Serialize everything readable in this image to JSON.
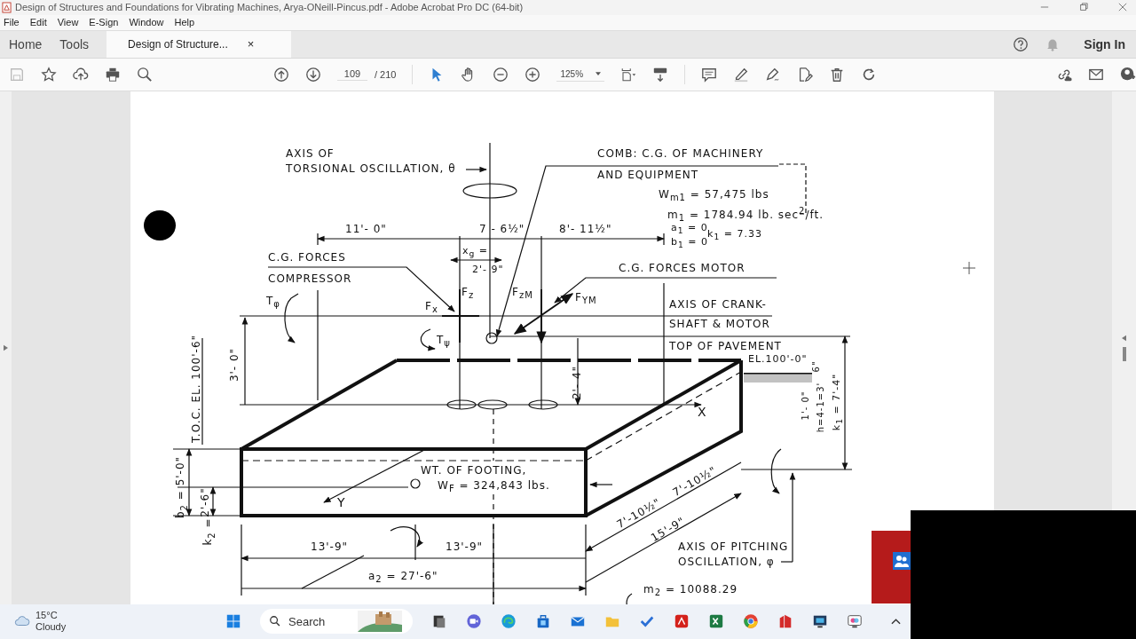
{
  "window": {
    "title": "Design of Structures and Foundations for Vibrating Machines, Arya-ONeill-Pincus.pdf - Adobe Acrobat Pro DC (64-bit)"
  },
  "menu": [
    "File",
    "Edit",
    "View",
    "E-Sign",
    "Window",
    "Help"
  ],
  "tabs": [
    {
      "label": "Home",
      "selected": false,
      "kind": "nav"
    },
    {
      "label": "Tools",
      "selected": false,
      "kind": "nav"
    },
    {
      "label": "Design of Structure...",
      "selected": true,
      "kind": "doc",
      "close": "×"
    }
  ],
  "sign_in": "Sign In",
  "toolbar": {
    "page": "109",
    "page_total": "/ 210",
    "zoom": "125%"
  },
  "drawing": {
    "labels": [
      {
        "text": "AXIS OF"
      },
      {
        "text": "TORSIONAL OSCILLATION, θ"
      },
      {
        "text": "COMB: C.G. OF MACHINERY"
      },
      {
        "text": "AND EQUIPMENT"
      },
      {
        "text": "W$_{m1}$ = 57,475 lbs"
      },
      {
        "text": "m$_{1}$ = 1784.94 lb. sec$^{2}$/ft."
      },
      {
        "text": "a$_{1}$ = 0"
      },
      {
        "text": "b$_{1}$ = 0"
      },
      {
        "text": "k$_{1}$ = 7.33"
      },
      {
        "text": "11'- 0\""
      },
      {
        "text": "7 - 6½\""
      },
      {
        "text": "8'- 11½\""
      },
      {
        "text": "x$_{g}$ ="
      },
      {
        "text": "2'- 9\""
      },
      {
        "text": "C.G. FORCES"
      },
      {
        "text": "COMPRESSOR"
      },
      {
        "text": "C.G. FORCES MOTOR"
      },
      {
        "text": "T$_{φ}$"
      },
      {
        "text": "F$_{x}$"
      },
      {
        "text": "F$_{z}$"
      },
      {
        "text": "F$_{zM}$"
      },
      {
        "text": "F$_{YM}$"
      },
      {
        "text": "AXIS OF CRANK-"
      },
      {
        "text": "SHAFT & MOTOR"
      },
      {
        "text": "T$_{ψ}$"
      },
      {
        "text": "TOP OF PAVEMENT"
      },
      {
        "text": "EL.100'-0\""
      },
      {
        "text": "T.O.C. EL. 100'-6\""
      },
      {
        "text": "3'- 0\""
      },
      {
        "text": "2'- 4\""
      },
      {
        "text": "6\""
      },
      {
        "text": "1'- 0\""
      },
      {
        "text": "h=4-1=3'"
      },
      {
        "text": "k$_{1}$ = 7'-4\""
      },
      {
        "text": "X"
      },
      {
        "text": "WT. OF FOOTING,"
      },
      {
        "text": "W$_{F}$ = 324,843 lbs."
      },
      {
        "text": "Y"
      },
      {
        "text": "b$_{2}$ = 5'-0\""
      },
      {
        "text": "2'-6\""
      },
      {
        "text": "k$_{2}$ ="
      },
      {
        "text": "13'-9\""
      },
      {
        "text": "13'-9\""
      },
      {
        "text": "a$_{2}$ = 27'-6\""
      },
      {
        "text": "7'-10½\""
      },
      {
        "text": "7'-10½\""
      },
      {
        "text": "15'-9\""
      },
      {
        "text": "AXIS OF PITCHING"
      },
      {
        "text": "OSCILLATION, φ"
      },
      {
        "text": "m$_{2}$ = 10088.29"
      }
    ]
  },
  "taskbar": {
    "temperature": "15°C",
    "weather": "Cloudy",
    "search_placeholder": "Search"
  }
}
